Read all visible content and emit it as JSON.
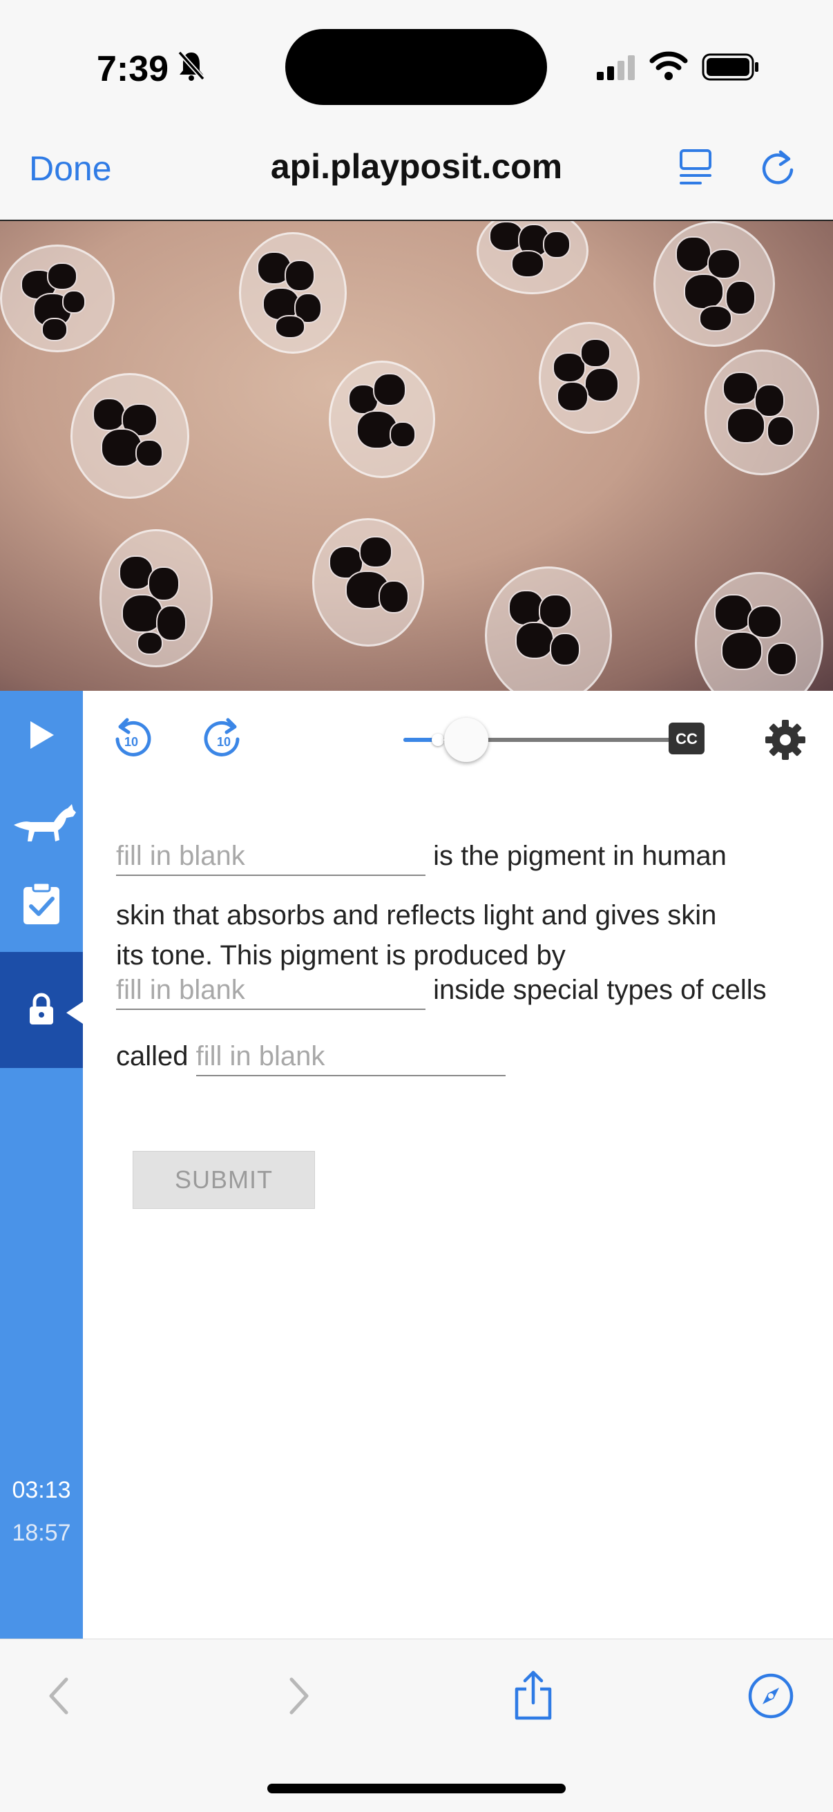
{
  "status_bar": {
    "time": "7:39"
  },
  "browser": {
    "done_label": "Done",
    "url": "api.playposit.com"
  },
  "player": {
    "sidebar": {
      "current_time": "03:13",
      "total_time": "18:57"
    },
    "progress_fraction": 0.17,
    "question": {
      "text_1": "is the pigment in human",
      "text_2": "skin that absorbs and reflects light and gives skin",
      "text_3": "its tone. This pigment is produced by",
      "text_4": "inside special types of cells",
      "text_5": "called",
      "blank_placeholder": "fill in blank",
      "submit_label": "SUBMIT"
    }
  },
  "colors": {
    "accent": "#2f7be5",
    "sidebar": "#4a93e8",
    "sidebar_active": "#1c4ea8"
  },
  "icons": [
    "bell-slash-icon",
    "signal-icon",
    "wifi-icon",
    "battery-icon",
    "reader-icon",
    "reload-icon",
    "play-icon",
    "rewind-10-icon",
    "forward-10-icon",
    "cc-icon",
    "gear-icon",
    "dog-icon",
    "clipboard-check-icon",
    "lock-icon",
    "back-icon",
    "forward-icon",
    "share-icon",
    "compass-icon"
  ]
}
